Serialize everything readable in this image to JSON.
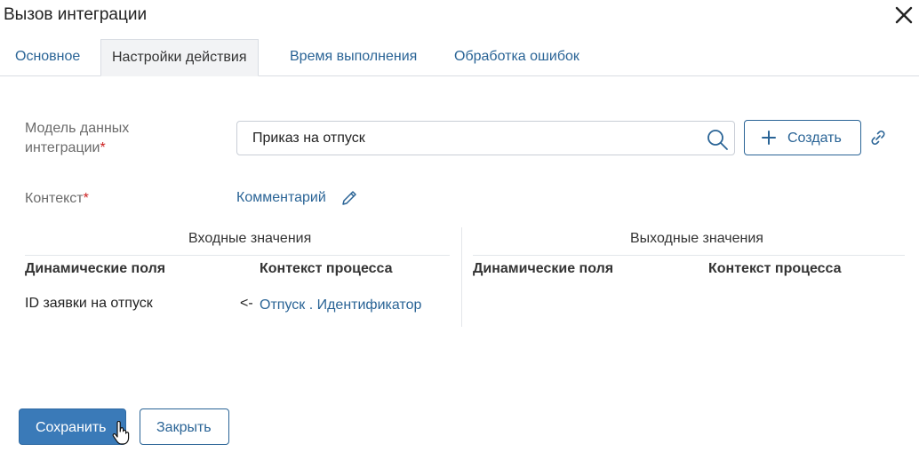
{
  "dialog": {
    "title": "Вызов интеграции"
  },
  "tabs": [
    {
      "label": "Основное",
      "active": false
    },
    {
      "label": "Настройки действия",
      "active": true
    },
    {
      "label": "Время выполнения",
      "active": false
    },
    {
      "label": "Обработка ошибок",
      "active": false
    }
  ],
  "form": {
    "model_label": "Модель данных интеграции",
    "model_label_line1": "Модель данных",
    "model_label_line2": "интеграции",
    "required_mark": "*",
    "model_value": "Приказ на отпуск",
    "create_label": "Создать",
    "context_label": "Контекст",
    "context_value": "Комментарий"
  },
  "mapping": {
    "inputs": {
      "title": "Входные значения",
      "col1": "Динамические поля",
      "col2": "Контекст процесса",
      "rows": [
        {
          "field": "ID заявки на отпуск",
          "arrow": "<-",
          "context": "Отпуск . Идентификатор"
        }
      ]
    },
    "outputs": {
      "title": "Выходные значения",
      "col1": "Динамические поля",
      "col2": "Контекст процесса",
      "rows": []
    }
  },
  "footer": {
    "save_label": "Сохранить",
    "close_label": "Закрыть"
  },
  "colors": {
    "accent": "#2a6496",
    "primary_button": "#3a7ab8",
    "required": "#cc2020",
    "active_tab_bg": "#f2f3f5"
  },
  "icons": [
    "close-icon",
    "search-icon",
    "plus-icon",
    "link-icon",
    "pencil-icon",
    "hand-cursor-icon"
  ]
}
